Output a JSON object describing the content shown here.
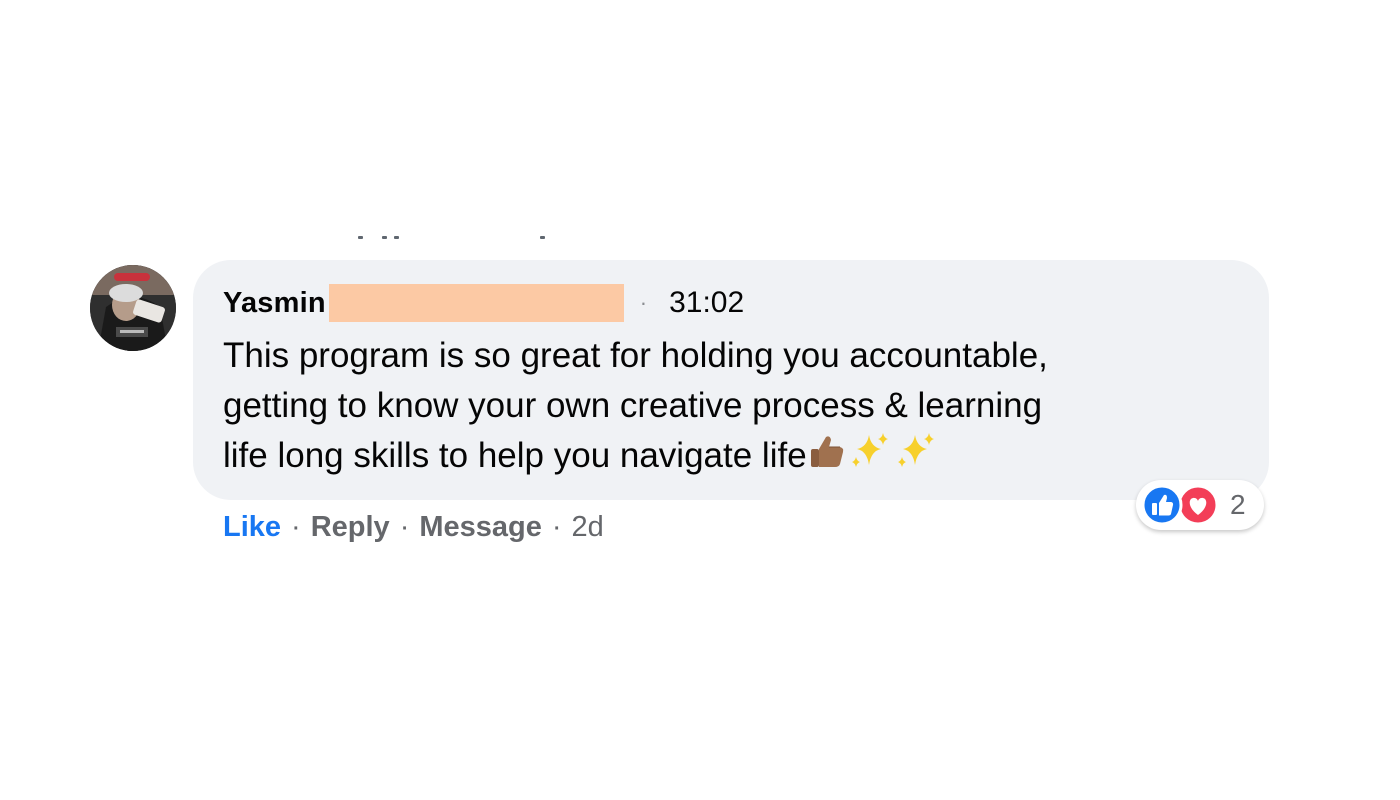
{
  "comment": {
    "author": "Yasmin",
    "timestamp_separator": "·",
    "timestamp": "31:02",
    "text_lines": [
      "This program is so great for holding you accountable,",
      "getting to know your own creative process & learning",
      "life long skills to help you navigate life"
    ],
    "trailing_emojis": [
      "thumbs-up-medium-skin-tone",
      "sparkles",
      "sparkles"
    ],
    "redaction_color": "#fcc9a4"
  },
  "actions": {
    "like_label": "Like",
    "reply_label": "Reply",
    "message_label": "Message",
    "separator": "·",
    "age": "2d"
  },
  "reactions": {
    "types": [
      "like",
      "love"
    ],
    "count": "2"
  },
  "colors": {
    "bubble": "#f0f2f5",
    "like_blue": "#1877f2",
    "love_red": "#f33e58",
    "muted_text": "#65676b"
  }
}
